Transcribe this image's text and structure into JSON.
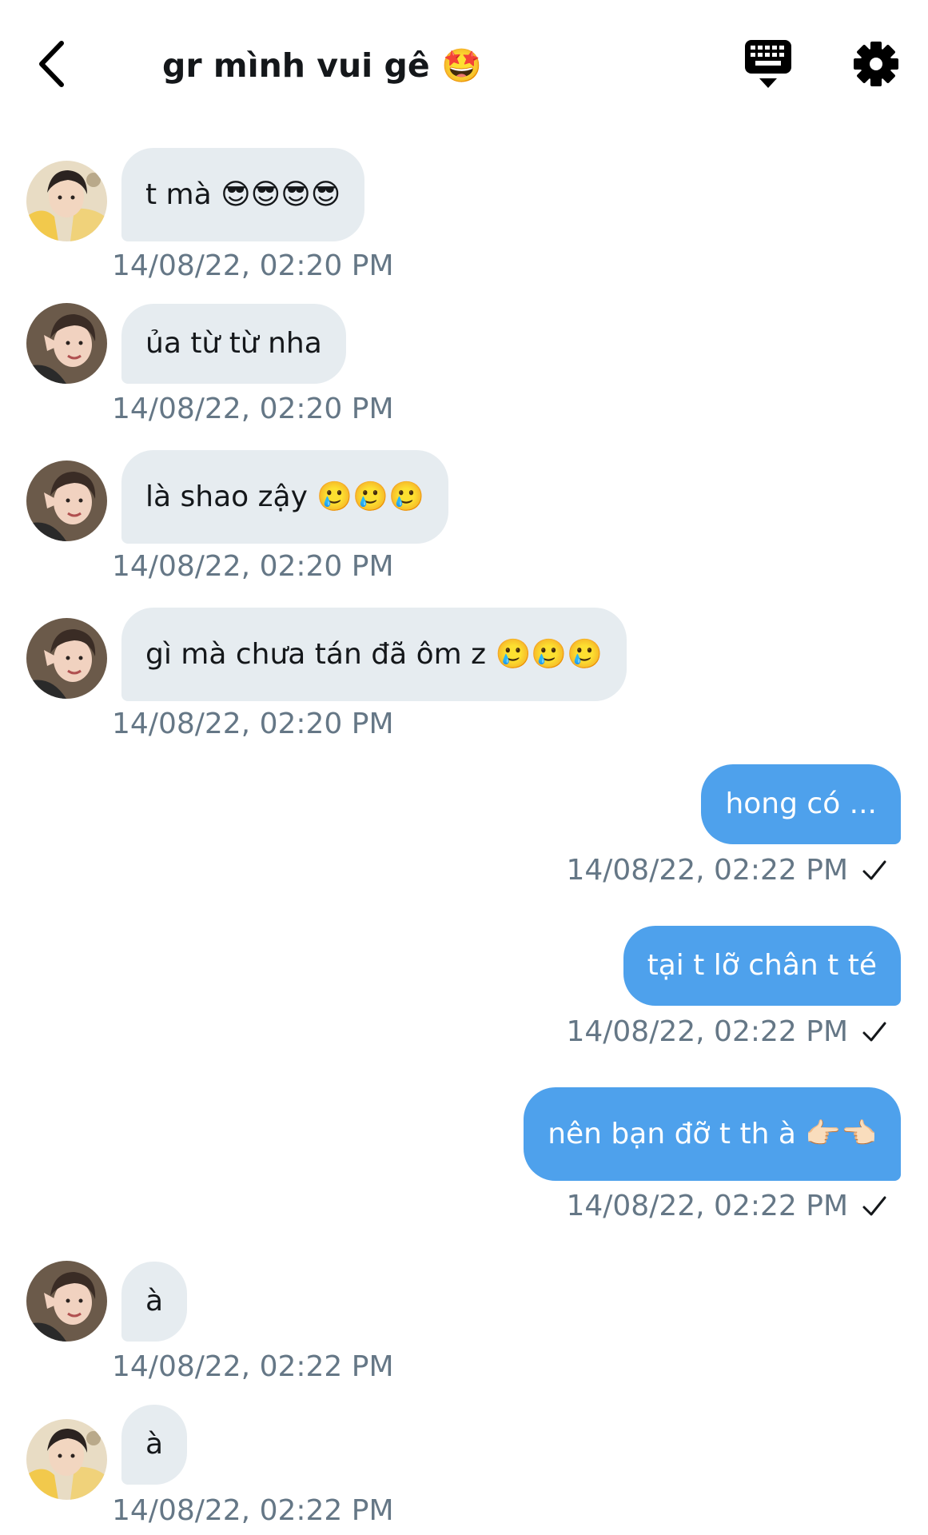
{
  "header": {
    "title": "gr mình vui gê 🤩"
  },
  "messages": [
    {
      "text": "t mà 😎😎😎😎",
      "timestamp": "14/08/22, 02:20 PM"
    },
    {
      "text": "ủa từ từ nha",
      "timestamp": "14/08/22, 02:20 PM"
    },
    {
      "text": "là shao zậy 🥲🥲🥲",
      "timestamp": "14/08/22, 02:20 PM"
    },
    {
      "text": "gì mà chưa tán đã ôm z 🥲🥲🥲",
      "timestamp": "14/08/22, 02:20 PM"
    },
    {
      "text": "hong có ...",
      "timestamp": "14/08/22, 02:22 PM"
    },
    {
      "text": "tại t lỡ chân t té",
      "timestamp": "14/08/22, 02:22 PM"
    },
    {
      "text": "nên bạn đỡ t th à 👉🏻👈🏻",
      "timestamp": "14/08/22, 02:22 PM"
    },
    {
      "text": "à",
      "timestamp": "14/08/22, 02:22 PM"
    },
    {
      "text": "à",
      "timestamp": "14/08/22, 02:22 PM"
    }
  ],
  "colors": {
    "incoming_bubble": "#e6ecf0",
    "outgoing_bubble": "#4ea1ec",
    "timestamp": "#657786",
    "text": "#14171a"
  },
  "icons": {
    "back": "chevron-left-icon",
    "keyboard": "keyboard-icon",
    "settings": "gear-icon",
    "read_receipt": "check-icon"
  }
}
